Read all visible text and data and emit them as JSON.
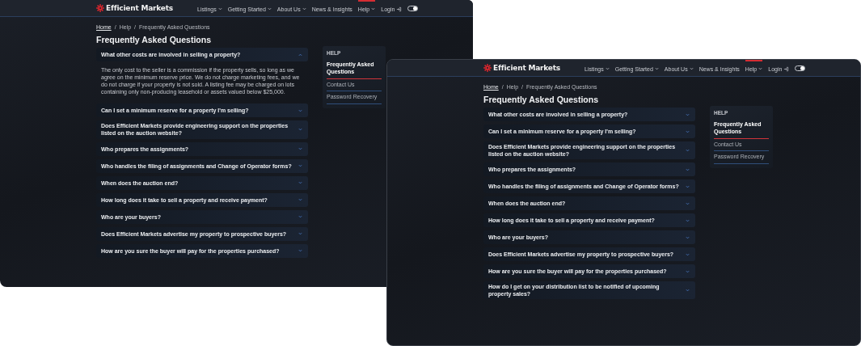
{
  "windows": [
    {
      "brand": "Efficient Markets",
      "nav": [
        {
          "label": "Listings",
          "has_menu": true,
          "selected": false
        },
        {
          "label": "Getting Started",
          "has_menu": true,
          "selected": false
        },
        {
          "label": "About Us",
          "has_menu": true,
          "selected": false
        },
        {
          "label": "News & Insights",
          "has_menu": false,
          "selected": false
        },
        {
          "label": "Help",
          "has_menu": true,
          "selected": true
        }
      ],
      "login": "Login",
      "dark_mode": true,
      "breadcrumb_separator": "/",
      "breadcrumb": [
        {
          "label": "Home",
          "link": true
        },
        {
          "label": "Help",
          "link": false
        },
        {
          "label": "Frequently Asked Questions",
          "link": false
        }
      ],
      "title": "Frequently Asked Questions",
      "faqs": [
        {
          "question": "What other costs are involved in selling a property?",
          "expanded": true,
          "answer": "The only cost to the seller is a commission if the property sells, so long as we agree on the minimum reserve price. We do not charge marketing fees, and we do not charge if your property is not sold. A listing fee may be charged on lots containing only non-producing leasehold or assets valued below $25,000."
        },
        {
          "question": "Can I set a minimum reserve for a property I'm selling?",
          "expanded": false
        },
        {
          "question": "Does Efficient Markets provide engineering support on the properties listed on the auction website?",
          "expanded": false
        },
        {
          "question": "Who prepares the assignments?",
          "expanded": false
        },
        {
          "question": "Who handles the filing of assignments and Change of Operator forms?",
          "expanded": false
        },
        {
          "question": "When does the auction end?",
          "expanded": false
        },
        {
          "question": "How long does it take to sell a property and receive payment?",
          "expanded": false
        },
        {
          "question": "Who are your buyers?",
          "expanded": false
        },
        {
          "question": "Does Efficient Markets advertise my property to prospective buyers?",
          "expanded": false
        },
        {
          "question": "How are you sure the buyer will pay for the properties purchased?",
          "expanded": false
        }
      ],
      "sidebar": {
        "heading": "HELP",
        "links": [
          {
            "label": "Frequently Asked Questions",
            "selected": true
          },
          {
            "label": "Contact Us",
            "selected": false
          },
          {
            "label": "Password Recovery",
            "selected": false
          }
        ]
      }
    },
    {
      "brand": "Efficient Markets",
      "nav": [
        {
          "label": "Listings",
          "has_menu": true,
          "selected": false
        },
        {
          "label": "Getting Started",
          "has_menu": true,
          "selected": false
        },
        {
          "label": "About Us",
          "has_menu": true,
          "selected": false
        },
        {
          "label": "News & Insights",
          "has_menu": false,
          "selected": false
        },
        {
          "label": "Help",
          "has_menu": true,
          "selected": true
        }
      ],
      "login": "Login",
      "dark_mode": true,
      "breadcrumb_separator": "/",
      "breadcrumb": [
        {
          "label": "Home",
          "link": true
        },
        {
          "label": "Help",
          "link": false
        },
        {
          "label": "Frequently Asked Questions",
          "link": false
        }
      ],
      "title": "Frequently Asked Questions",
      "faqs": [
        {
          "question": "What other costs are involved in selling a property?",
          "expanded": false
        },
        {
          "question": "Can I set a minimum reserve for a property I'm selling?",
          "expanded": false
        },
        {
          "question": "Does Efficient Markets provide engineering support on the properties listed on the auction website?",
          "expanded": false
        },
        {
          "question": "Who prepares the assignments?",
          "expanded": false
        },
        {
          "question": "Who handles the filing of assignments and Change of Operator forms?",
          "expanded": false
        },
        {
          "question": "When does the auction end?",
          "expanded": false
        },
        {
          "question": "How long does it take to sell a property and receive payment?",
          "expanded": false
        },
        {
          "question": "Who are your buyers?",
          "expanded": false
        },
        {
          "question": "Does Efficient Markets advertise my property to prospective buyers?",
          "expanded": false
        },
        {
          "question": "How are you sure the buyer will pay for the properties purchased?",
          "expanded": false
        },
        {
          "question": "How do I get on your distribution list to be notified of upcoming property sales?",
          "expanded": false
        }
      ],
      "sidebar": {
        "heading": "HELP",
        "links": [
          {
            "label": "Frequently Asked Questions",
            "selected": true
          },
          {
            "label": "Contact Us",
            "selected": false
          },
          {
            "label": "Password Recovery",
            "selected": false
          }
        ]
      }
    }
  ]
}
